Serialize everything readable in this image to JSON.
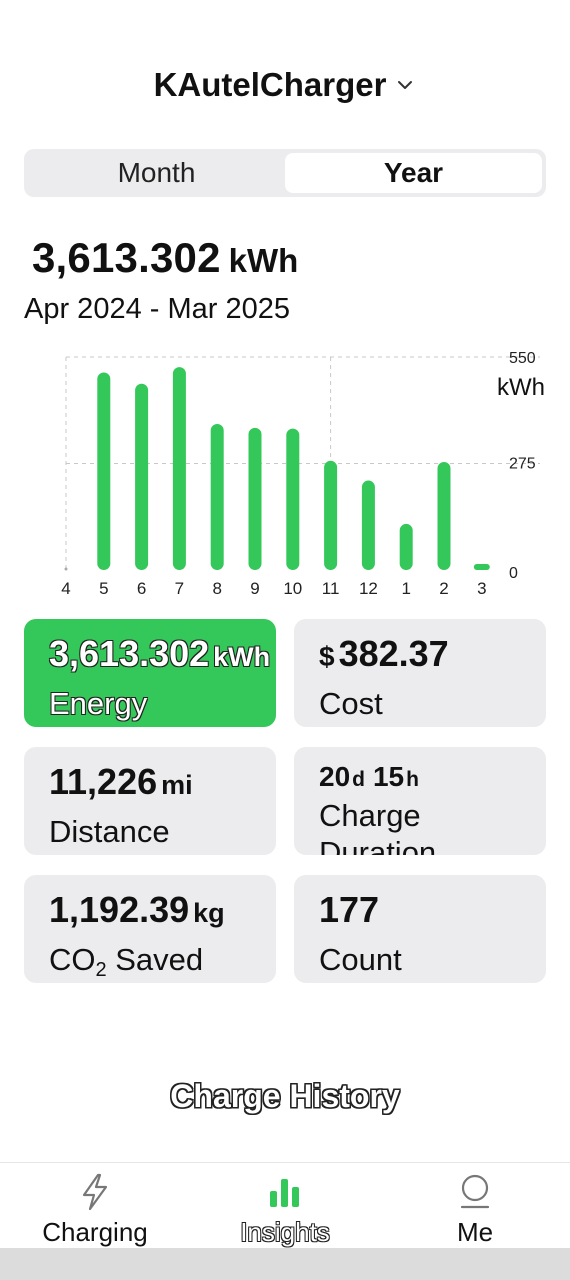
{
  "header": {
    "device_name": "KAutelCharger"
  },
  "period_toggle": {
    "month_label": "Month",
    "year_label": "Year",
    "selected": "Year"
  },
  "summary": {
    "total_value": "3,613.302",
    "total_unit": "kWh",
    "date_range": "Apr 2024 - Mar 2025"
  },
  "chart_data": {
    "type": "bar",
    "categories": [
      "4",
      "5",
      "6",
      "7",
      "8",
      "9",
      "10",
      "11",
      "12",
      "1",
      "2",
      "3"
    ],
    "values": [
      0,
      510,
      481,
      524,
      377,
      367,
      365,
      282,
      231,
      119,
      279,
      8
    ],
    "ylim": [
      0,
      550
    ],
    "y_ticks": [
      "0",
      "275",
      "550"
    ],
    "y_unit": "kWh",
    "bar_color": "#34c759",
    "grid": true
  },
  "stats": {
    "energy": {
      "value": "3,613.302",
      "unit": "kWh",
      "label": "Energy"
    },
    "cost": {
      "prefix": "$",
      "value": "382.37",
      "label": "Cost"
    },
    "distance": {
      "value": "11,226",
      "unit": "mi",
      "label": "Distance"
    },
    "duration": {
      "days": "20",
      "days_unit": "d",
      "hours": "15",
      "hours_unit": "h",
      "label": "Charge Duration"
    },
    "co2": {
      "value": "1,192.39",
      "unit": "kg",
      "label_prefix": "CO",
      "label_sub": "2",
      "label_suffix": " Saved"
    },
    "count": {
      "value": "177",
      "label": "Count"
    }
  },
  "history": {
    "title": "Charge History"
  },
  "tabs": [
    {
      "label": "Charging",
      "icon": "lightning-icon"
    },
    {
      "label": "Insights",
      "icon": "bar-chart-icon",
      "active": true
    },
    {
      "label": "Me",
      "icon": "person-icon"
    }
  ],
  "colors": {
    "accent": "#34c759",
    "card_bg": "#ececee"
  }
}
